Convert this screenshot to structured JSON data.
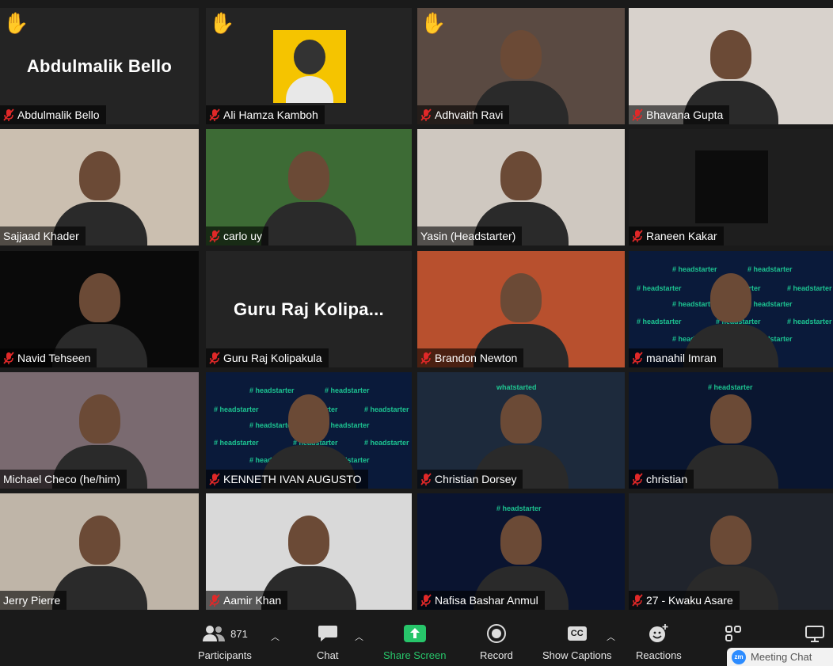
{
  "participants": [
    {
      "name": "Abdulmalik Bello",
      "muted": true,
      "hand_raised": true,
      "display": "Abdulmalik Bello",
      "bg": "#242424"
    },
    {
      "name": "Ali Hamza Kamboh",
      "muted": true,
      "hand_raised": true,
      "bg": "#242424"
    },
    {
      "name": "Adhvaith Ravi",
      "muted": true,
      "hand_raised": true,
      "bg": "#5a4a42"
    },
    {
      "name": "Bhavana Gupta",
      "muted": true,
      "hand_raised": false,
      "bg": "#d8d2cc"
    },
    {
      "name": "Sajjaad Khader",
      "muted": false,
      "hand_raised": false,
      "bg": "#cbbfb0"
    },
    {
      "name": "carlo uy",
      "muted": true,
      "hand_raised": false,
      "bg": "#3d6b35"
    },
    {
      "name": "Yasin (Headstarter)",
      "muted": false,
      "hand_raised": false,
      "active": true,
      "bg": "#cfc8c0"
    },
    {
      "name": "Raneen Kakar",
      "muted": true,
      "hand_raised": false,
      "bg": "#1e1e1e"
    },
    {
      "name": "Navid Tehseen",
      "muted": true,
      "hand_raised": false,
      "bg": "#0a0a0a"
    },
    {
      "name": "Guru Raj Kolipakula",
      "muted": true,
      "hand_raised": false,
      "display": "Guru  Raj  Kolipa...",
      "bg": "#242424"
    },
    {
      "name": "Brandon Newton",
      "muted": true,
      "hand_raised": false,
      "bg": "#b8502e"
    },
    {
      "name": "manahil Imran",
      "muted": true,
      "hand_raised": false,
      "bg": "#0a1a3a"
    },
    {
      "name": "Michael Checo (he/him)",
      "muted": false,
      "hand_raised": false,
      "bg": "#7a6a70"
    },
    {
      "name": "KENNETH IVAN AUGUSTO",
      "muted": true,
      "hand_raised": false,
      "bg": "#0a1a3a"
    },
    {
      "name": "Christian Dorsey",
      "muted": true,
      "hand_raised": false,
      "bg": "#1d2a3c"
    },
    {
      "name": "christian",
      "muted": true,
      "hand_raised": false,
      "bg": "#0a1630"
    },
    {
      "name": "Jerry Pierre",
      "muted": false,
      "hand_raised": false,
      "bg": "#bfb5a8"
    },
    {
      "name": "Aamir Khan",
      "muted": true,
      "hand_raised": false,
      "bg": "#d9d9d9"
    },
    {
      "name": "Nafisa Bashar Anmul",
      "muted": true,
      "hand_raised": false,
      "bg": "#0a1430"
    },
    {
      "name": "27 - Kwaku Asare",
      "muted": true,
      "hand_raised": false,
      "bg": "#20242c"
    }
  ],
  "background_text": "# headstarter",
  "christian_dorsey_bg_text": "whatstarted",
  "toolbar": {
    "participants_label": "Participants",
    "participants_count": "871",
    "chat_label": "Chat",
    "share_label": "Share Screen",
    "record_label": "Record",
    "captions_label": "Show Captions",
    "captions_badge": "CC",
    "reactions_label": "Reactions",
    "meeting_chat": "Meeting Chat",
    "zm": "zm"
  },
  "colors": {
    "share": "#27c56a",
    "mute": "#e02828",
    "active_outline": "#c8e06a"
  }
}
